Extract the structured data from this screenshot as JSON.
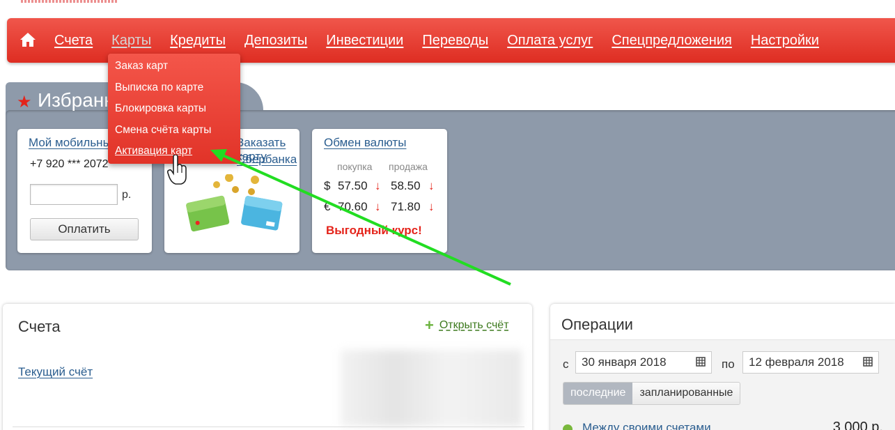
{
  "nav": {
    "items": [
      {
        "label": "Счета",
        "active": false
      },
      {
        "label": "Карты",
        "active": true
      },
      {
        "label": "Кредиты",
        "active": false
      },
      {
        "label": "Депозиты",
        "active": false
      },
      {
        "label": "Инвестиции",
        "active": false
      },
      {
        "label": "Переводы",
        "active": false
      },
      {
        "label": "Оплата услуг",
        "active": false
      },
      {
        "label": "Спецпредложения",
        "active": false
      },
      {
        "label": "Настройки",
        "active": false
      }
    ]
  },
  "cards_menu": {
    "items": [
      "Заказ карт",
      "Выписка по карте",
      "Блокировка карты",
      "Смена счёта карты",
      "Активация карт"
    ],
    "hovered_index": 4
  },
  "favorites": {
    "title": "Избранное",
    "mobile": {
      "title": "Мой мобильный",
      "phone": "+7 920 *** 2072",
      "amount_value": "",
      "currency": "р.",
      "pay_label": "Оплатить"
    },
    "order_card": {
      "title_line1": "Заказать карту",
      "title_line2": "Сбербанка"
    },
    "fx": {
      "title": "Обмен валюты",
      "buy_label": "покупка",
      "sell_label": "продажа",
      "rows": [
        {
          "symbol": "$",
          "buy": "57.50",
          "sell": "58.50",
          "trend": "↓"
        },
        {
          "symbol": "€",
          "buy": "70.60",
          "sell": "71.80",
          "trend": "↓"
        }
      ],
      "promo": "Выгодный курс!"
    }
  },
  "accounts": {
    "title": "Счета",
    "open_label": "Открыть счёт",
    "items": [
      "Текущий счёт"
    ]
  },
  "operations": {
    "title": "Операции",
    "from_label": "с",
    "from_date": "30 января 2018",
    "to_label": "по",
    "to_date": "12 февраля 2018",
    "tabs": [
      {
        "label": "последние",
        "active": true
      },
      {
        "label": "запланированные",
        "active": false
      }
    ],
    "rows": [
      {
        "name": "Между своими счетами",
        "amount": "3 000 р."
      }
    ]
  },
  "colors": {
    "brand_red": "#e4231a",
    "link_blue": "#2a5d8f",
    "panel_grey": "#8e9aaa",
    "annotation_green": "#22dd22"
  }
}
